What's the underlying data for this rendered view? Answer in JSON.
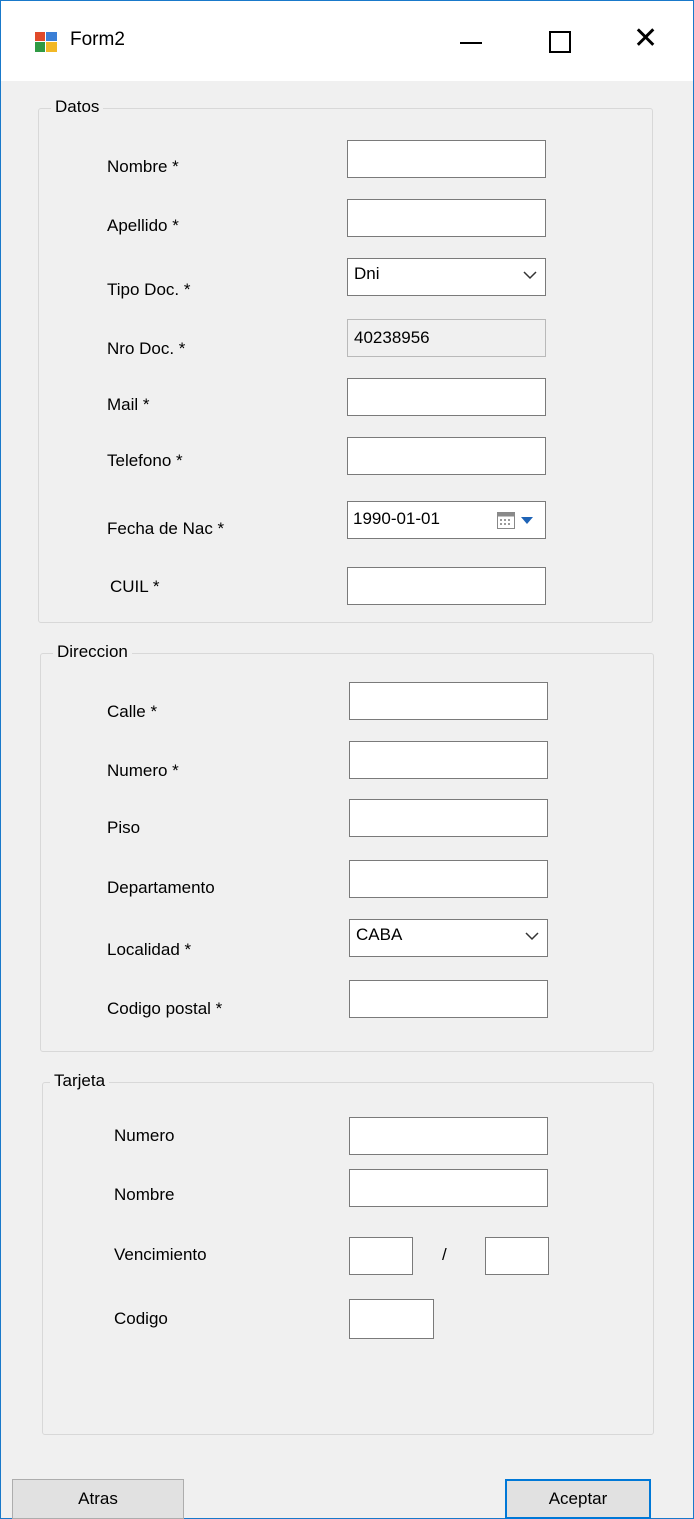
{
  "window": {
    "title": "Form2",
    "minimize": "—",
    "maximize": "",
    "close": "✕"
  },
  "datos": {
    "legend": "Datos",
    "nombre_label": "Nombre *",
    "nombre_value": "",
    "apellido_label": "Apellido *",
    "apellido_value": "",
    "tipo_doc_label": "Tipo Doc. *",
    "tipo_doc_value": "Dni",
    "nro_doc_label": "Nro Doc. *",
    "nro_doc_value": "40238956",
    "mail_label": "Mail *",
    "mail_value": "",
    "telefono_label": "Telefono *",
    "telefono_value": "",
    "fecha_label": "Fecha de Nac *",
    "fecha_value": "1990-01-01",
    "cuil_label": "CUIL *",
    "cuil_value": ""
  },
  "direccion": {
    "legend": "Direccion",
    "calle_label": "Calle *",
    "numero_label": "Numero *",
    "piso_label": "Piso",
    "departamento_label": "Departamento",
    "localidad_label": "Localidad *",
    "localidad_value": "CABA",
    "codigo_postal_label": "Codigo postal *"
  },
  "tarjeta": {
    "legend": "Tarjeta",
    "numero_label": "Numero",
    "nombre_label": "Nombre",
    "vencimiento_label": "Vencimiento",
    "vencimiento_separator": "/",
    "codigo_label": "Codigo"
  },
  "buttons": {
    "atras": "Atras",
    "aceptar": "Aceptar"
  }
}
